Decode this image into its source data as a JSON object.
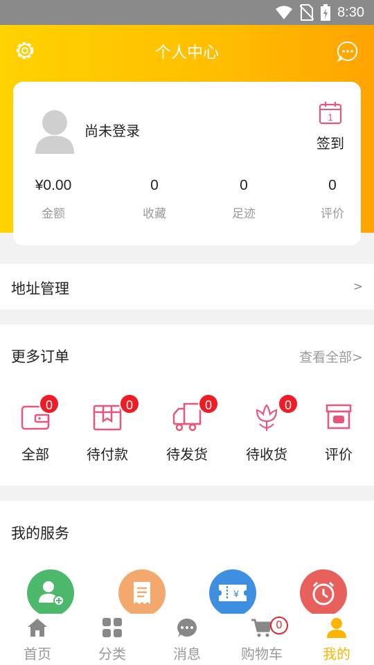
{
  "status_bar": {
    "time": "8:30"
  },
  "header": {
    "title": "个人中心",
    "accent": "#ffc000"
  },
  "profile": {
    "login_text": "尚未登录",
    "signin_label": "签到",
    "calendar_day": "1",
    "stats": [
      {
        "value": "¥0.00",
        "label": "金额"
      },
      {
        "value": "0",
        "label": "收藏"
      },
      {
        "value": "0",
        "label": "足迹"
      },
      {
        "value": "0",
        "label": "评价"
      }
    ]
  },
  "address": {
    "label": "地址管理",
    "arrow": ">"
  },
  "orders": {
    "title": "更多订单",
    "view_all": "查看全部>",
    "items": [
      {
        "label": "全部",
        "badge": "0",
        "icon": "wallet-icon"
      },
      {
        "label": "待付款",
        "badge": "0",
        "icon": "package-icon"
      },
      {
        "label": "待发货",
        "badge": "0",
        "icon": "truck-icon"
      },
      {
        "label": "待收货",
        "badge": "0",
        "icon": "flower-icon"
      },
      {
        "label": "评价",
        "icon": "archive-icon"
      }
    ]
  },
  "services": {
    "title": "我的服务",
    "items": [
      {
        "icon": "add-user-icon",
        "color": "#4cb86b"
      },
      {
        "icon": "receipt-icon",
        "color": "#f3a96e"
      },
      {
        "icon": "coupon-icon",
        "color": "#3f8fe0"
      },
      {
        "icon": "alarm-clock-icon",
        "color": "#e8605c"
      }
    ]
  },
  "tabbar": {
    "items": [
      {
        "label": "首页",
        "icon": "home-icon"
      },
      {
        "label": "分类",
        "icon": "category-icon"
      },
      {
        "label": "消息",
        "icon": "message-icon"
      },
      {
        "label": "购物车",
        "icon": "cart-icon",
        "badge": "0"
      },
      {
        "label": "我的",
        "icon": "user-icon",
        "active": true
      }
    ],
    "active_color": "#ffb400",
    "inactive_color": "#999999"
  }
}
